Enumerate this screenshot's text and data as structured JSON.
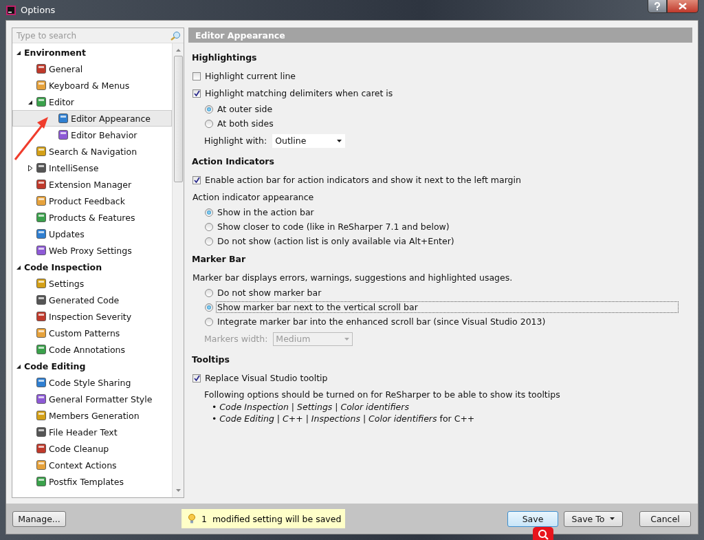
{
  "window": {
    "title": "Options"
  },
  "search": {
    "placeholder": "Type to search"
  },
  "tree": [
    {
      "label": "Environment",
      "expanded": true,
      "children": [
        {
          "label": "General",
          "selected": false
        },
        {
          "label": "Keyboard & Menus",
          "selected": false
        },
        {
          "label": "Editor",
          "selected": false,
          "expanded": true,
          "children": [
            {
              "label": "Editor Appearance",
              "selected": true
            },
            {
              "label": "Editor Behavior",
              "selected": false
            }
          ]
        },
        {
          "label": "Search & Navigation",
          "selected": false
        },
        {
          "label": "IntelliSense",
          "selected": false,
          "expanded": false
        },
        {
          "label": "Extension Manager",
          "selected": false
        },
        {
          "label": "Product Feedback",
          "selected": false
        },
        {
          "label": "Products & Features",
          "selected": false
        },
        {
          "label": "Updates",
          "selected": false
        },
        {
          "label": "Web Proxy Settings",
          "selected": false
        }
      ]
    },
    {
      "label": "Code Inspection",
      "expanded": true,
      "children": [
        {
          "label": "Settings",
          "selected": false
        },
        {
          "label": "Generated Code",
          "selected": false
        },
        {
          "label": "Inspection Severity",
          "selected": false
        },
        {
          "label": "Custom Patterns",
          "selected": false
        },
        {
          "label": "Code Annotations",
          "selected": false
        }
      ]
    },
    {
      "label": "Code Editing",
      "expanded": true,
      "children": [
        {
          "label": "Code Style Sharing",
          "selected": false
        },
        {
          "label": "General Formatter Style",
          "selected": false
        },
        {
          "label": "Members Generation",
          "selected": false
        },
        {
          "label": "File Header Text",
          "selected": false
        },
        {
          "label": "Code Cleanup",
          "selected": false
        },
        {
          "label": "Context Actions",
          "selected": false
        },
        {
          "label": "Postfix Templates",
          "selected": false
        }
      ]
    }
  ],
  "page": {
    "title": "Editor Appearance",
    "sections": [
      {
        "heading": "Highlightings",
        "items": [
          {
            "kind": "checkbox",
            "label": "Highlight current line",
            "checked": false
          },
          {
            "kind": "checkbox",
            "label": "Highlight matching delimiters when caret is",
            "checked": true
          },
          {
            "kind": "radio",
            "label": "At outer side",
            "selected": true,
            "focused": false
          },
          {
            "kind": "radio",
            "label": "At both sides",
            "selected": false,
            "focused": false
          },
          {
            "kind": "dropdown",
            "label": "Highlight with:",
            "value": "Outline",
            "disabled": false
          }
        ]
      },
      {
        "heading": "Action Indicators",
        "items": [
          {
            "kind": "checkbox",
            "label": "Enable action bar for action indicators and show it next to the left margin",
            "checked": true
          },
          {
            "kind": "text",
            "label": "Action indicator appearance"
          },
          {
            "kind": "radio",
            "label": "Show in the action bar",
            "selected": true,
            "focused": false
          },
          {
            "kind": "radio",
            "label": "Show closer to code (like in ReSharper 7.1 and below)",
            "selected": false,
            "focused": false
          },
          {
            "kind": "radio",
            "label": "Do not show (action list is only available via Alt+Enter)",
            "selected": false,
            "focused": false
          }
        ]
      },
      {
        "heading": "Marker Bar",
        "items": [
          {
            "kind": "text",
            "label": "Marker bar displays errors, warnings, suggestions and highlighted usages."
          },
          {
            "kind": "radio",
            "label": "Do not show marker bar",
            "selected": false,
            "focused": false
          },
          {
            "kind": "radio",
            "label": "Show marker bar next to the vertical scroll bar",
            "selected": true,
            "focused": true
          },
          {
            "kind": "radio",
            "label": "Integrate marker bar into the enhanced scroll bar (since Visual Studio 2013)",
            "selected": false,
            "focused": false
          },
          {
            "kind": "dropdown",
            "label": "Markers width:",
            "value": "Medium",
            "disabled": true
          }
        ]
      },
      {
        "heading": "Tooltips",
        "items": [
          {
            "kind": "checkbox",
            "label": "Replace Visual Studio tooltip",
            "checked": true
          },
          {
            "kind": "note",
            "label": "Following options should be turned on for ReSharper to be able to show its tooltips",
            "bullets": [
              "• *Code Inspection | Settings | Color identifiers*",
              "• *Code Editing | C++ | Inspections | Color identifiers* for C++"
            ]
          }
        ]
      }
    ]
  },
  "footer": {
    "manage": "Manage...",
    "notice": "1  modified setting will be saved",
    "buttons": [
      {
        "label": "Save",
        "focused": true,
        "menu": false
      },
      {
        "label": "Save To",
        "focused": false,
        "menu": true
      },
      {
        "label": "Cancel",
        "focused": false,
        "menu": false
      }
    ]
  }
}
